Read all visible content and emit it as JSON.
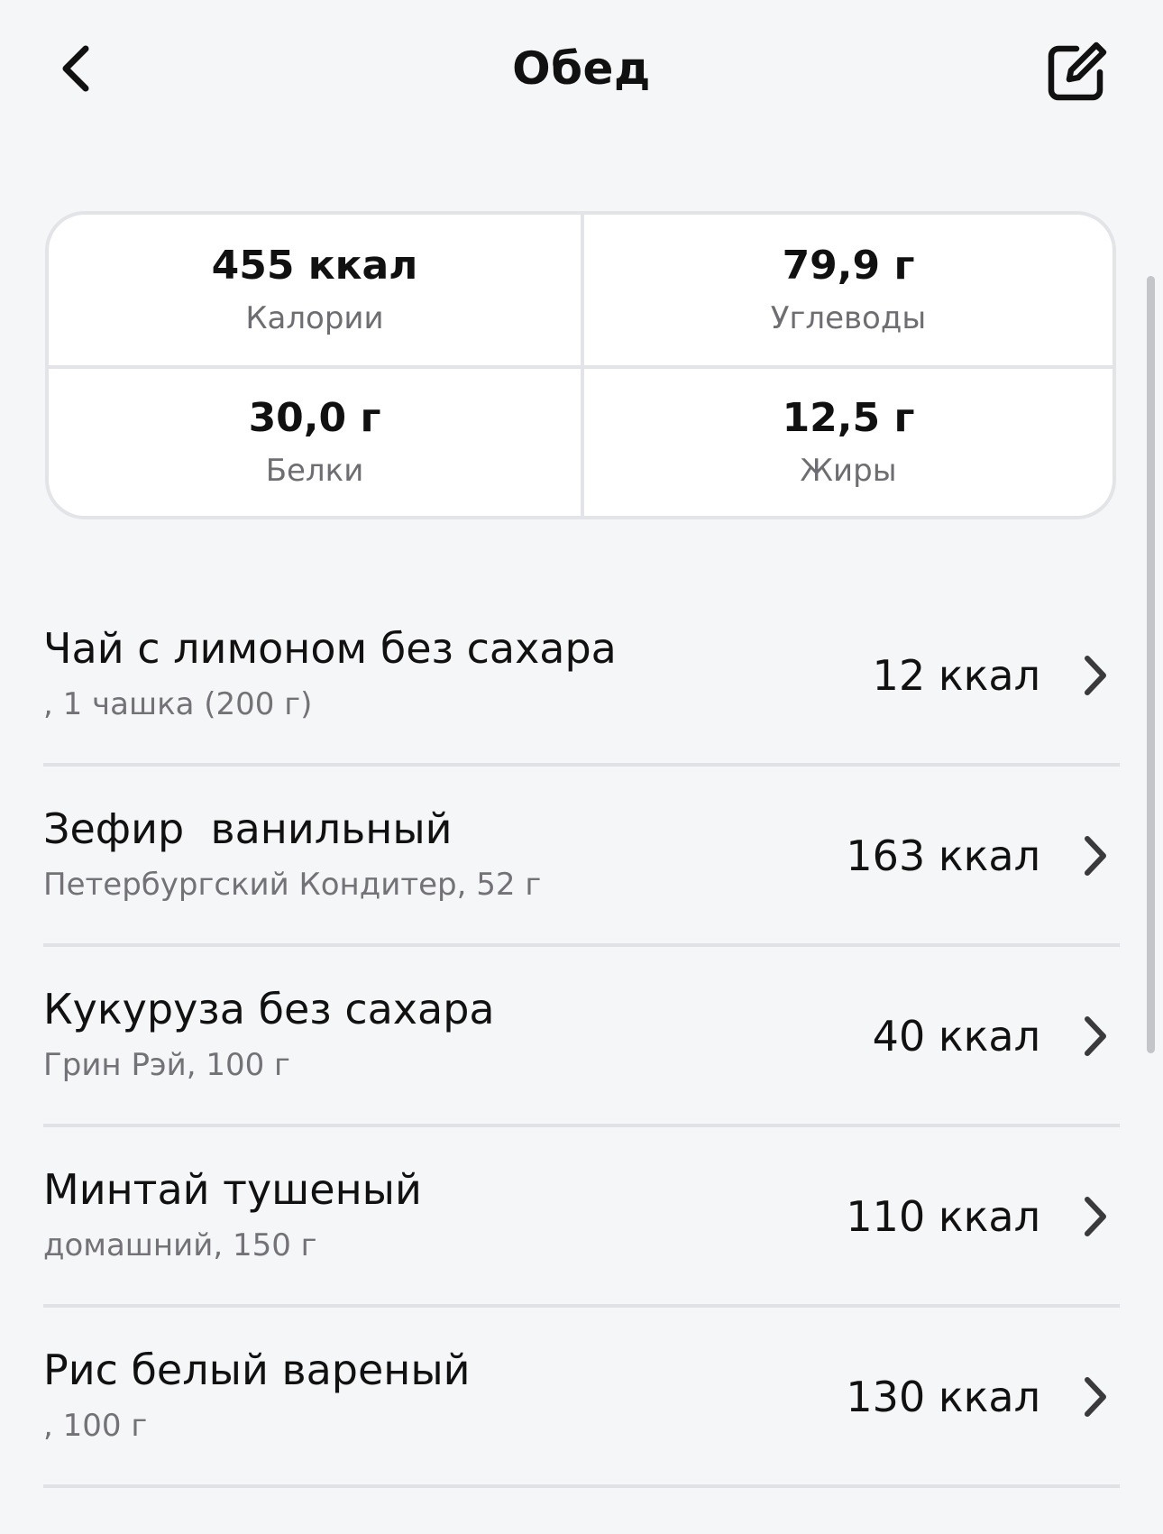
{
  "header": {
    "title": "Обед",
    "back_icon": "chevron-left-icon",
    "edit_icon": "edit-icon"
  },
  "summary": {
    "calories": {
      "value": "455 ккал",
      "label": "Калории"
    },
    "carbs": {
      "value": "79,9 г",
      "label": "Углеводы"
    },
    "protein": {
      "value": "30,0 г",
      "label": "Белки"
    },
    "fat": {
      "value": "12,5 г",
      "label": "Жиры"
    }
  },
  "items": [
    {
      "name": "Чай с лимоном без сахара",
      "detail": ", 1 чашка (200 г)",
      "kcal": "12 ккал"
    },
    {
      "name": "Зефир  ванильный",
      "detail": "Петербургский Кондитер, 52 г",
      "kcal": "163 ккал"
    },
    {
      "name": "Кукуруза без сахара",
      "detail": "Грин Рэй, 100 г",
      "kcal": "40 ккал"
    },
    {
      "name": "Минтай тушеный",
      "detail": "домашний, 150 г",
      "kcal": "110 ккал"
    },
    {
      "name": "Рис белый вареный",
      "detail": ", 100 г",
      "kcal": "130 ккал"
    }
  ],
  "colors": {
    "background": "#f5f6f8",
    "card_border": "#e3e4e7",
    "secondary_text": "#727277"
  }
}
